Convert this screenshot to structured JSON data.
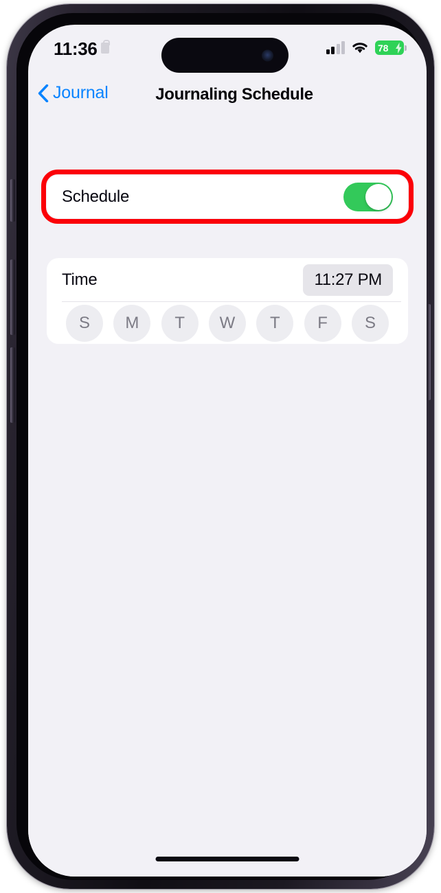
{
  "device": {
    "frame_color": "#2b2733",
    "screen_background": "#f2f1f6"
  },
  "status_bar": {
    "time": "11:36",
    "lock_icon": "lock-icon",
    "signal_icon": "cellular-signal-icon",
    "signal_bars_filled": 2,
    "signal_bars_total": 4,
    "wifi_icon": "wifi-icon",
    "battery_percent": "78",
    "battery_charging": true,
    "battery_color": "#2fd257"
  },
  "nav_bar": {
    "back_icon": "chevron-left-icon",
    "back_label": "Journal",
    "back_color": "#0a84ff",
    "title": "Journaling Schedule"
  },
  "schedule_section": {
    "label": "Schedule",
    "toggle_on": true,
    "toggle_on_color": "#33c95a",
    "highlight_color": "#fb0007"
  },
  "time_section": {
    "label": "Time",
    "time_value": "11:27 PM",
    "days": [
      {
        "letter": "S",
        "name": "sunday",
        "selected": false
      },
      {
        "letter": "M",
        "name": "monday",
        "selected": false
      },
      {
        "letter": "T",
        "name": "tuesday",
        "selected": false
      },
      {
        "letter": "W",
        "name": "wednesday",
        "selected": false
      },
      {
        "letter": "T",
        "name": "thursday",
        "selected": false
      },
      {
        "letter": "F",
        "name": "friday",
        "selected": false
      },
      {
        "letter": "S",
        "name": "saturday",
        "selected": false
      }
    ]
  },
  "home_indicator": "home-indicator"
}
